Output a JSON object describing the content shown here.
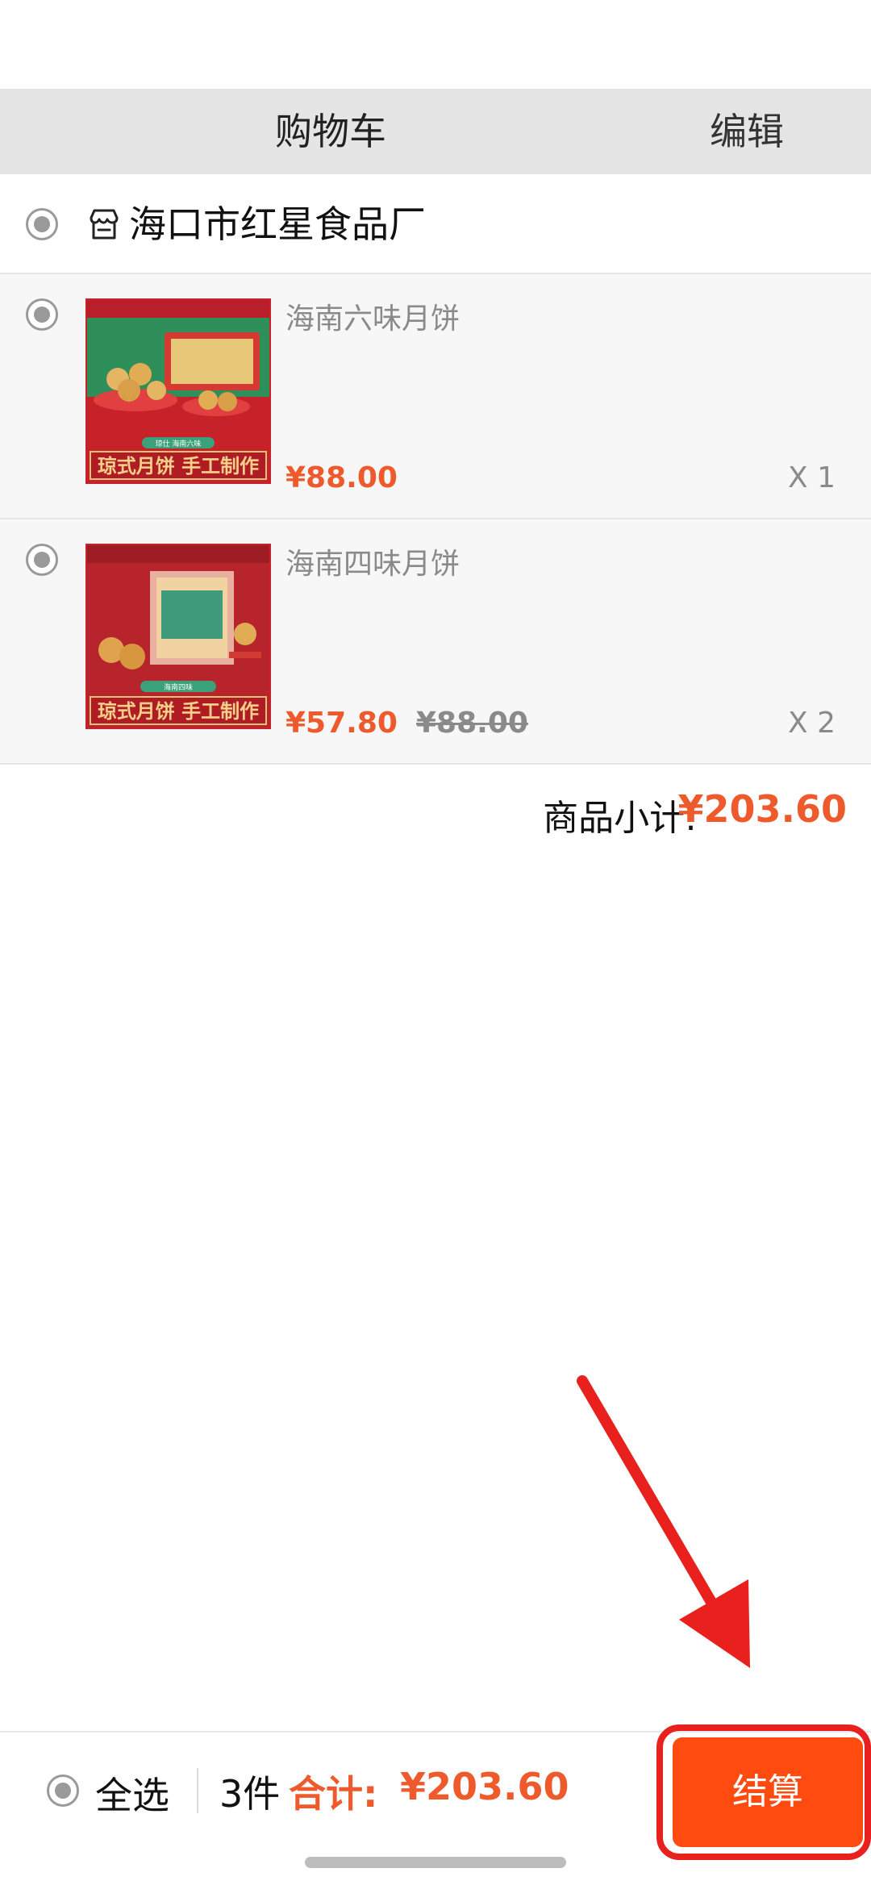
{
  "header": {
    "title": "购物车",
    "edit_label": "编辑"
  },
  "store": {
    "name": "海口市红星食品厂"
  },
  "items": [
    {
      "name": "海南六味月饼",
      "price": "¥88.00",
      "original_price": "",
      "quantity": "X 1",
      "image": {
        "banner_text": "琼式月饼 手工制作",
        "tag_text": "琼仕 海南六味"
      }
    },
    {
      "name": "海南四味月饼",
      "price": "¥57.80",
      "original_price": "¥88.00",
      "quantity": "X 2",
      "image": {
        "banner_text": "琼式月饼 手工制作",
        "tag_text": "海南四味"
      }
    }
  ],
  "subtotal": {
    "label": "商品小计:",
    "value": "¥203.60"
  },
  "footer": {
    "select_all_label": "全选",
    "count": "3件",
    "total_label": "合计:",
    "total_value": "¥203.60",
    "checkout_label": "结算"
  },
  "colors": {
    "accent": "#ee5a2c",
    "checkout_bg": "#ff4a10",
    "highlight": "#e8211e"
  }
}
